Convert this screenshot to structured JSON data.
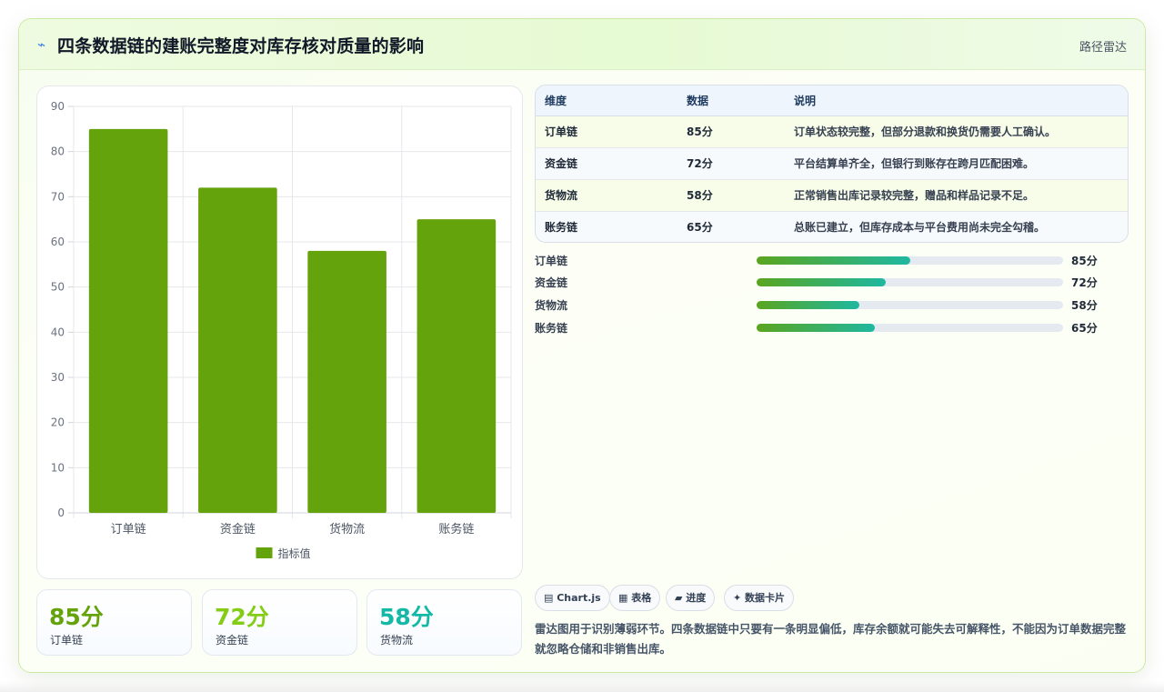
{
  "header": {
    "icon": "⌁",
    "title": "四条数据链的建账完整度对库存核对质量的影响",
    "right_label": "路径雷达"
  },
  "chart_data": {
    "type": "bar",
    "categories": [
      "订单链",
      "资金链",
      "货物流",
      "账务链"
    ],
    "series": [
      {
        "name": "指标值",
        "values": [
          85,
          72,
          58,
          65
        ],
        "color": "#65a30d"
      }
    ],
    "ylim": [
      0,
      90
    ],
    "yticks": [
      0,
      10,
      20,
      30,
      40,
      50,
      60,
      70,
      80,
      90
    ],
    "grid": true,
    "legend": "bottom"
  },
  "stats": [
    {
      "value": "85分",
      "label": "订单链",
      "color": "#65a30d"
    },
    {
      "value": "72分",
      "label": "资金链",
      "color": "#84cc16"
    },
    {
      "value": "58分",
      "label": "货物流",
      "color": "#14b8a6"
    }
  ],
  "table": {
    "headers": [
      "维度",
      "数据",
      "说明"
    ],
    "rows": [
      [
        "订单链",
        "85分",
        "订单状态较完整，但部分退款和换货仍需要人工确认。"
      ],
      [
        "资金链",
        "72分",
        "平台结算单齐全，但银行到账存在跨月匹配困难。"
      ],
      [
        "货物流",
        "58分",
        "正常销售出库记录较完整，赠品和样品记录不足。"
      ],
      [
        "账务链",
        "65分",
        "总账已建立，但库存成本与平台费用尚未完全勾稽。"
      ]
    ]
  },
  "progress": [
    {
      "label": "订单链",
      "value": "85分",
      "fraction": 0.5
    },
    {
      "label": "资金链",
      "value": "72分",
      "fraction": 0.42
    },
    {
      "label": "货物流",
      "value": "58分",
      "fraction": 0.335
    },
    {
      "label": "账务链",
      "value": "65分",
      "fraction": 0.385
    }
  ],
  "chips": [
    "▤ Chart.js",
    "▦ 表格",
    "▰ 进度",
    "✦ 数据卡片"
  ],
  "note": "雷达图用于识别薄弱环节。四条数据链中只要有一条明显偏低，库存余额就可能失去可解释性，不能因为订单数据完整就忽略仓储和非销售出库。"
}
